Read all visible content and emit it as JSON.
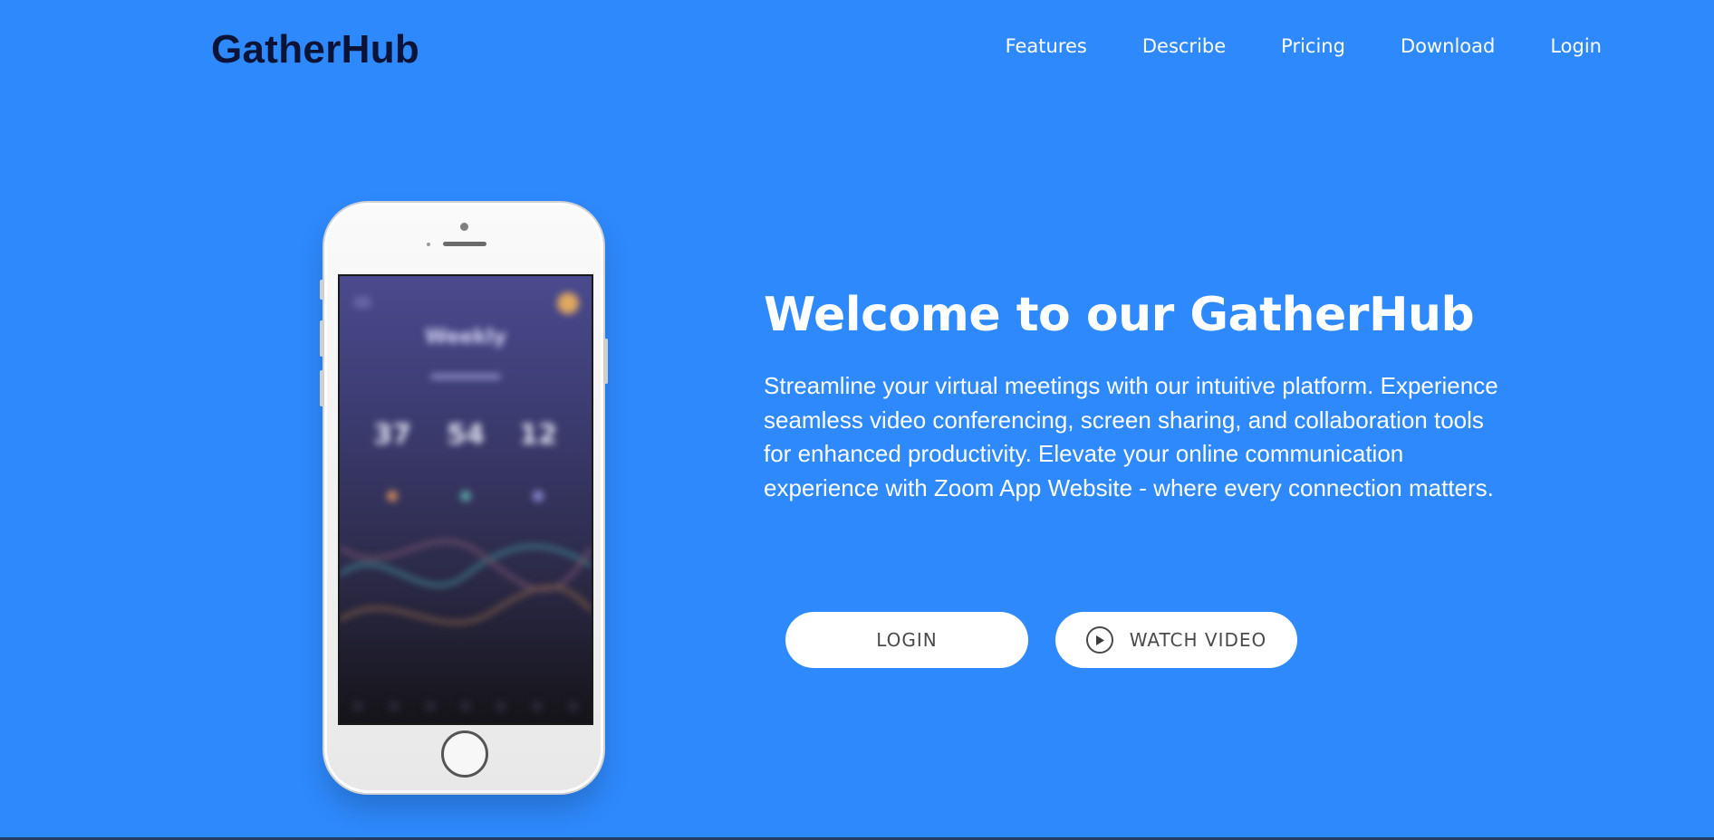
{
  "brand": {
    "name": "GatherHub"
  },
  "nav": {
    "items": [
      {
        "label": "Features"
      },
      {
        "label": "Describe"
      },
      {
        "label": "Pricing"
      },
      {
        "label": "Download"
      },
      {
        "label": "Login"
      }
    ]
  },
  "hero": {
    "title": "Welcome to our GatherHub",
    "description": "Streamline your virtual meetings with our intuitive platform. Experience seamless video conferencing, screen sharing, and collaboration tools for enhanced productivity. Elevate your online communication experience with Zoom App Website - where every connection matters.",
    "buttons": {
      "login_label": "LOGIN",
      "watch_video_label": "WATCH VIDEO"
    }
  },
  "phone_screen": {
    "heading": "Weekly",
    "stats": [
      "37",
      "54",
      "12"
    ]
  },
  "icons": {
    "play": "play-circle-icon"
  },
  "colors": {
    "background": "#2e89fc",
    "logo": "#0b1437",
    "button_bg": "#ffffff",
    "button_text": "#4a4a4a"
  }
}
